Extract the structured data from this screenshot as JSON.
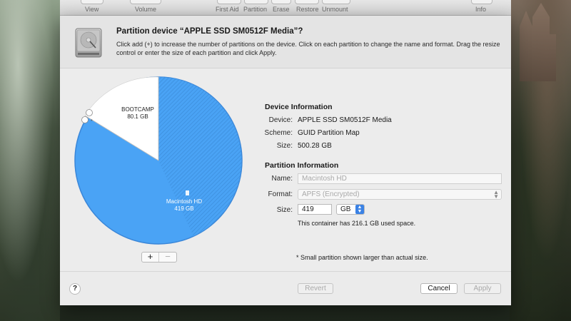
{
  "toolbar": {
    "items": [
      {
        "label": "View"
      },
      {
        "label": "Volume"
      },
      {
        "label": "First Aid"
      },
      {
        "label": "Partition"
      },
      {
        "label": "Erase"
      },
      {
        "label": "Restore"
      },
      {
        "label": "Unmount"
      },
      {
        "label": "Info"
      }
    ]
  },
  "sheet": {
    "title": "Partition device “APPLE SSD SM0512F Media”?",
    "description": "Click add (+) to increase the number of partitions on the device. Click on each partition to change the name and format. Drag the resize control or enter the size of each partition and click Apply."
  },
  "pie": {
    "partitions": [
      {
        "name": "BOOTCAMP",
        "size": "80.1 GB",
        "color": "#ffffff"
      },
      {
        "name": "Macintosh HD",
        "size": "419 GB",
        "color": "#4aa3f5"
      }
    ],
    "add_label": "+",
    "remove_label": "−"
  },
  "device_info": {
    "title": "Device Information",
    "device_key": "Device:",
    "device_val": "APPLE SSD SM0512F Media",
    "scheme_key": "Scheme:",
    "scheme_val": "GUID Partition Map",
    "size_key": "Size:",
    "size_val": "500.28 GB"
  },
  "partition_info": {
    "title": "Partition Information",
    "name_key": "Name:",
    "name_placeholder": "Macintosh HD",
    "format_key": "Format:",
    "format_val": "APFS (Encrypted)",
    "size_key": "Size:",
    "size_val": "419",
    "unit_val": "GB",
    "used_note": "This container has 216.1 GB used space."
  },
  "small_note": "* Small partition shown larger than actual size.",
  "footer": {
    "help_label": "?",
    "revert_label": "Revert",
    "cancel_label": "Cancel",
    "apply_label": "Apply"
  },
  "colors": {
    "accent": "#3b82e5",
    "partition_blue": "#4aa3f5"
  }
}
